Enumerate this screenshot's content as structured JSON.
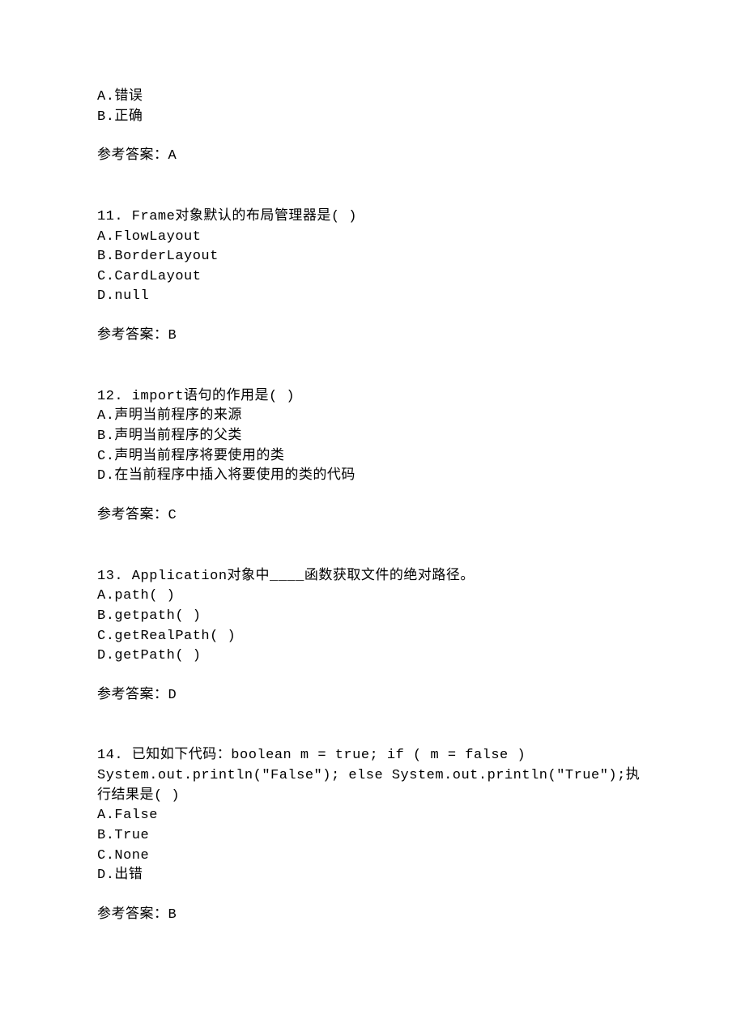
{
  "q10": {
    "opts": [
      "A.错误",
      "B.正确"
    ],
    "answer": "参考答案：A"
  },
  "q11": {
    "stem": "11. Frame对象默认的布局管理器是(  )",
    "opts": [
      "A.FlowLayout",
      "B.BorderLayout",
      "C.CardLayout",
      "D.null"
    ],
    "answer": "参考答案：B"
  },
  "q12": {
    "stem": "12. import语句的作用是(  )",
    "opts": [
      "A.声明当前程序的来源",
      "B.声明当前程序的父类",
      "C.声明当前程序将要使用的类",
      "D.在当前程序中插入将要使用的类的代码"
    ],
    "answer": "参考答案：C"
  },
  "q13": {
    "stem": "13. Application对象中____函数获取文件的绝对路径。",
    "opts": [
      "A.path(  )",
      "B.getpath(  )",
      "C.getRealPath(  )",
      "D.getPath(  )"
    ],
    "answer": "参考答案：D"
  },
  "q14": {
    "stem": "14. 已知如下代码：boolean m = true; if ( m = false ) System.out.println(\"False\"); else System.out.println(\"True\");执行结果是(  )",
    "opts": [
      "A.False",
      "B.True",
      "C.None",
      "D.出错"
    ],
    "answer": "参考答案：B"
  }
}
